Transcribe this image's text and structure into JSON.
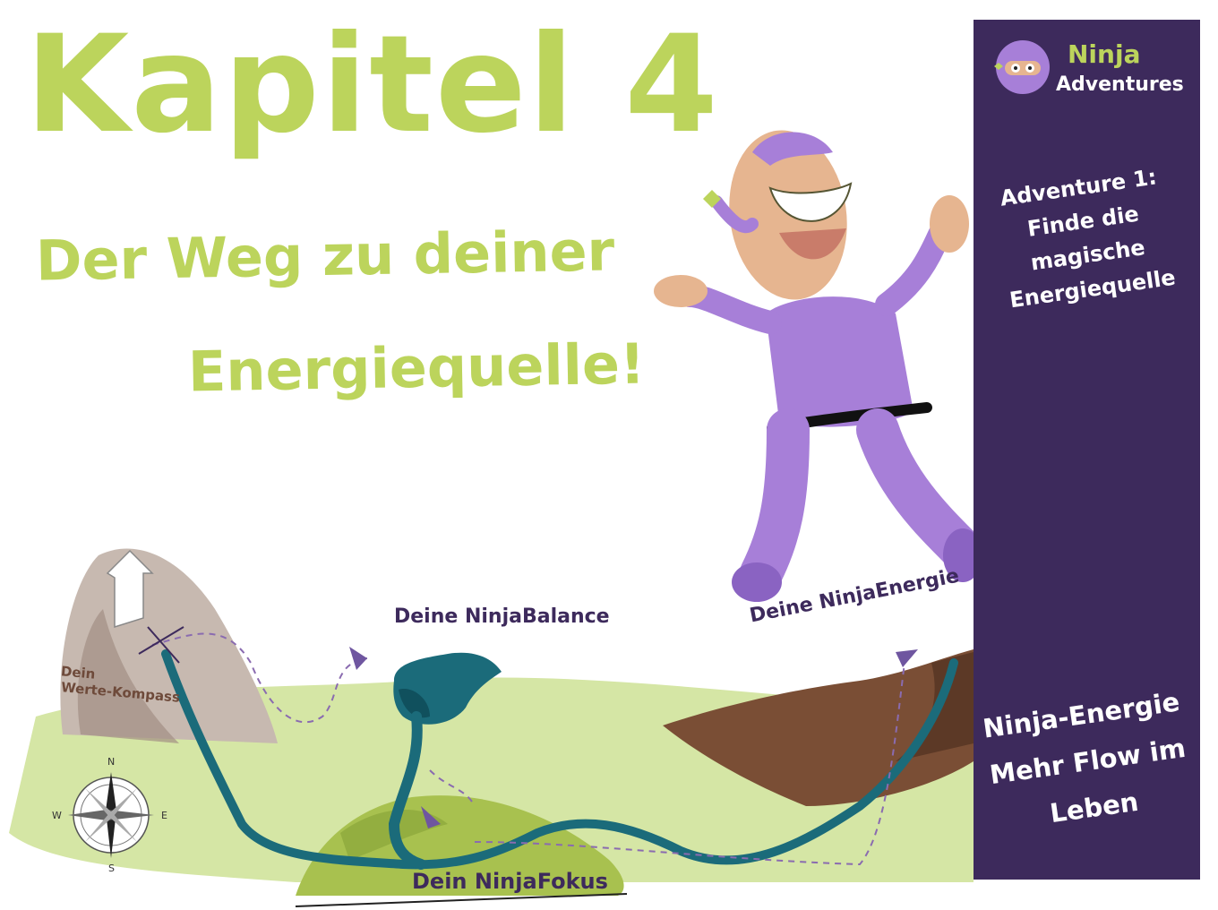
{
  "heading": {
    "title": "Kapitel 4",
    "subtitle_line1": "Der Weg zu deiner",
    "subtitle_line2": "Energiequelle!"
  },
  "sidebar": {
    "logo_line1": "Ninja",
    "logo_line2": "Adventures",
    "adventure_text": "Adventure 1: Finde die magische Energiequelle",
    "motto": "Ninja-Energie Mehr Flow im Leben"
  },
  "map": {
    "label_balance": "Deine NinjaBalance",
    "label_energie": "Deine NinjaEnergie",
    "label_fokus": "Dein NinjaFokus",
    "label_werte_line1": "Dein",
    "label_werte_line2": "Werte-Kompass",
    "compass": {
      "n": "N",
      "e": "E",
      "s": "S",
      "w": "W"
    }
  },
  "colors": {
    "lime": "#bcd45c",
    "purple_dark": "#3d2a5c",
    "ninja_purple": "#a77fd8",
    "teal": "#1b6b7a",
    "brown": "#7a4e35",
    "grass": "#d5e6a5"
  }
}
